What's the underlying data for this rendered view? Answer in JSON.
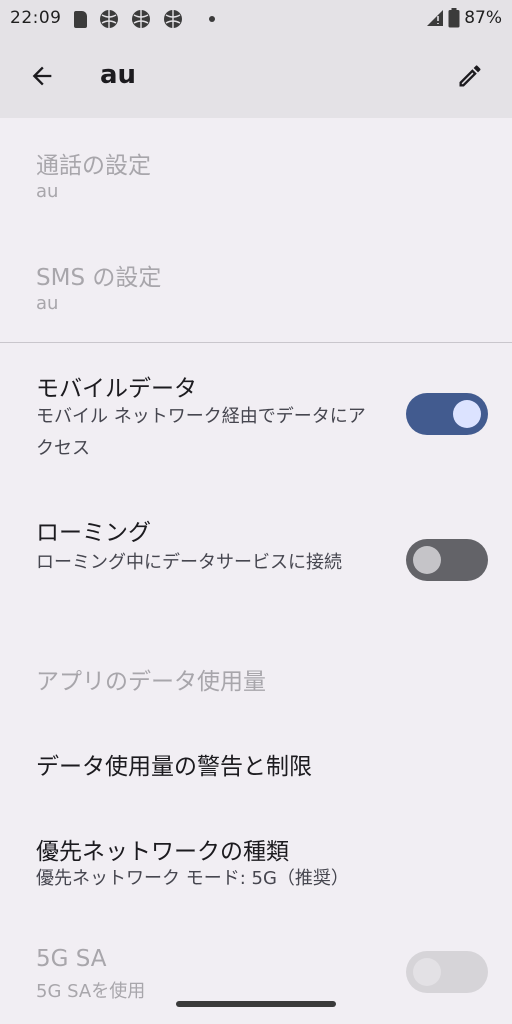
{
  "status_bar": {
    "time": "22:09",
    "battery": "87%",
    "icons": [
      "sd-card-icon",
      "ball-icon",
      "ball-icon",
      "ball-icon",
      "dot-icon",
      "signal-icon",
      "battery-icon"
    ]
  },
  "app_bar": {
    "title": "au",
    "back_icon": "arrow-left-icon",
    "edit_icon": "pencil-icon"
  },
  "settings": {
    "call": {
      "title": "通話の設定",
      "summary": "au"
    },
    "sms": {
      "title": "SMS の設定",
      "summary": "au"
    },
    "mobile_data": {
      "title": "モバイルデータ",
      "summary": "モバイル ネットワーク経由でデータにアクセス",
      "enabled": true
    },
    "roaming": {
      "title": "ローミング",
      "summary": "ローミング中にデータサービスに接続",
      "enabled": false
    },
    "app_data_usage": {
      "title": "アプリのデータ使用量"
    },
    "data_warning": {
      "title": "データ使用量の警告と制限"
    },
    "network_type": {
      "title": "優先ネットワークの種類",
      "summary": "優先ネットワーク モード: 5G（推奨）"
    },
    "fiveg_sa": {
      "title": "5G SA",
      "summary": "5G SAを使用"
    }
  },
  "colors": {
    "toggle_on": "#425b8f",
    "toggle_off": "#636368",
    "app_bar": "#e4e2e6",
    "background": "#f1eef3"
  }
}
